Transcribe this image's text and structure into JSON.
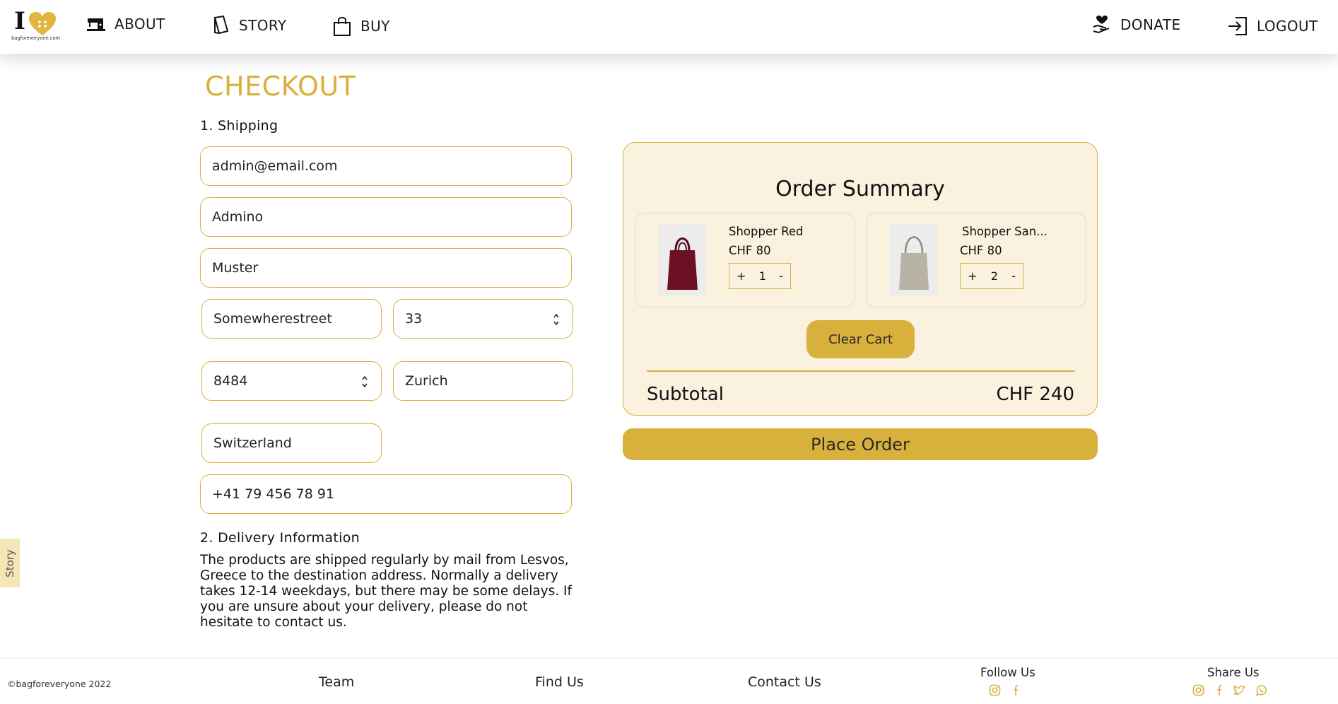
{
  "brand": {
    "logo_letter": "I",
    "logo_text": "bagforeveryone.com",
    "accent_color": "#d8b13c",
    "panel_color": "#faf2de"
  },
  "nav": {
    "about": "ABOUT",
    "story": "STORY",
    "buy": "BUY",
    "donate": "DONATE",
    "logout": "LOGOUT"
  },
  "page": {
    "title": "CHECKOUT"
  },
  "shipping": {
    "heading": "1. Shipping",
    "email": "admin@email.com",
    "first_name": "Admino",
    "last_name": "Muster",
    "street": "Somewherestreet",
    "house_number": "33",
    "zip": "8484",
    "city": "Zurich",
    "country": "Switzerland",
    "phone": "+41 79 456 78 91"
  },
  "delivery": {
    "heading": "2. Delivery Information",
    "text": "The products are shipped regularly by mail from Lesvos, Greece to the destination address. Normally a delivery takes 12-14 weekdays, but there may be some delays. If you are unsure about your delivery, please do not hesitate to contact us."
  },
  "summary": {
    "title": "Order Summary",
    "items": [
      {
        "name": "Shopper Red",
        "price": "CHF 80",
        "qty": "1",
        "plus": "+",
        "minus": "-",
        "image_color": "#6b0f22"
      },
      {
        "name": "Shopper San...",
        "price": "CHF 80",
        "qty": "2",
        "plus": "+",
        "minus": "-",
        "image_color": "#b9b3a6"
      }
    ],
    "clear_label": "Clear Cart",
    "subtotal_label": "Subtotal",
    "subtotal_value": "CHF 240",
    "place_order_label": "Place Order"
  },
  "story_tab": "Story",
  "footer": {
    "copyright": "©bagforeveryone 2022",
    "team": "Team",
    "find_us": "Find Us",
    "contact_us": "Contact Us",
    "follow_us": "Follow Us",
    "share_us": "Share Us",
    "follow_icons": [
      "instagram-icon",
      "facebook-icon"
    ],
    "share_icons": [
      "instagram-icon",
      "facebook-icon",
      "twitter-icon",
      "whatsapp-icon"
    ]
  }
}
